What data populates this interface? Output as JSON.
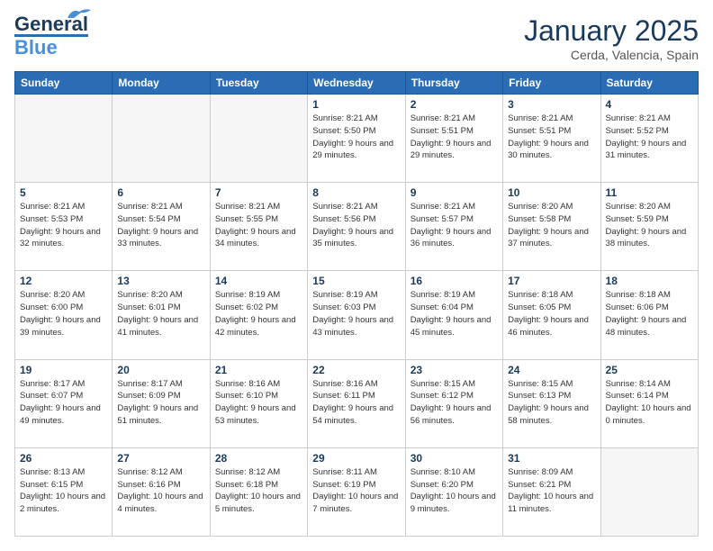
{
  "logo": {
    "line1": "General",
    "line2": "Blue"
  },
  "title": "January 2025",
  "location": "Cerda, Valencia, Spain",
  "days_header": [
    "Sunday",
    "Monday",
    "Tuesday",
    "Wednesday",
    "Thursday",
    "Friday",
    "Saturday"
  ],
  "weeks": [
    [
      {
        "day": "",
        "detail": ""
      },
      {
        "day": "",
        "detail": ""
      },
      {
        "day": "",
        "detail": ""
      },
      {
        "day": "1",
        "detail": "Sunrise: 8:21 AM\nSunset: 5:50 PM\nDaylight: 9 hours\nand 29 minutes."
      },
      {
        "day": "2",
        "detail": "Sunrise: 8:21 AM\nSunset: 5:51 PM\nDaylight: 9 hours\nand 29 minutes."
      },
      {
        "day": "3",
        "detail": "Sunrise: 8:21 AM\nSunset: 5:51 PM\nDaylight: 9 hours\nand 30 minutes."
      },
      {
        "day": "4",
        "detail": "Sunrise: 8:21 AM\nSunset: 5:52 PM\nDaylight: 9 hours\nand 31 minutes."
      }
    ],
    [
      {
        "day": "5",
        "detail": "Sunrise: 8:21 AM\nSunset: 5:53 PM\nDaylight: 9 hours\nand 32 minutes."
      },
      {
        "day": "6",
        "detail": "Sunrise: 8:21 AM\nSunset: 5:54 PM\nDaylight: 9 hours\nand 33 minutes."
      },
      {
        "day": "7",
        "detail": "Sunrise: 8:21 AM\nSunset: 5:55 PM\nDaylight: 9 hours\nand 34 minutes."
      },
      {
        "day": "8",
        "detail": "Sunrise: 8:21 AM\nSunset: 5:56 PM\nDaylight: 9 hours\nand 35 minutes."
      },
      {
        "day": "9",
        "detail": "Sunrise: 8:21 AM\nSunset: 5:57 PM\nDaylight: 9 hours\nand 36 minutes."
      },
      {
        "day": "10",
        "detail": "Sunrise: 8:20 AM\nSunset: 5:58 PM\nDaylight: 9 hours\nand 37 minutes."
      },
      {
        "day": "11",
        "detail": "Sunrise: 8:20 AM\nSunset: 5:59 PM\nDaylight: 9 hours\nand 38 minutes."
      }
    ],
    [
      {
        "day": "12",
        "detail": "Sunrise: 8:20 AM\nSunset: 6:00 PM\nDaylight: 9 hours\nand 39 minutes."
      },
      {
        "day": "13",
        "detail": "Sunrise: 8:20 AM\nSunset: 6:01 PM\nDaylight: 9 hours\nand 41 minutes."
      },
      {
        "day": "14",
        "detail": "Sunrise: 8:19 AM\nSunset: 6:02 PM\nDaylight: 9 hours\nand 42 minutes."
      },
      {
        "day": "15",
        "detail": "Sunrise: 8:19 AM\nSunset: 6:03 PM\nDaylight: 9 hours\nand 43 minutes."
      },
      {
        "day": "16",
        "detail": "Sunrise: 8:19 AM\nSunset: 6:04 PM\nDaylight: 9 hours\nand 45 minutes."
      },
      {
        "day": "17",
        "detail": "Sunrise: 8:18 AM\nSunset: 6:05 PM\nDaylight: 9 hours\nand 46 minutes."
      },
      {
        "day": "18",
        "detail": "Sunrise: 8:18 AM\nSunset: 6:06 PM\nDaylight: 9 hours\nand 48 minutes."
      }
    ],
    [
      {
        "day": "19",
        "detail": "Sunrise: 8:17 AM\nSunset: 6:07 PM\nDaylight: 9 hours\nand 49 minutes."
      },
      {
        "day": "20",
        "detail": "Sunrise: 8:17 AM\nSunset: 6:09 PM\nDaylight: 9 hours\nand 51 minutes."
      },
      {
        "day": "21",
        "detail": "Sunrise: 8:16 AM\nSunset: 6:10 PM\nDaylight: 9 hours\nand 53 minutes."
      },
      {
        "day": "22",
        "detail": "Sunrise: 8:16 AM\nSunset: 6:11 PM\nDaylight: 9 hours\nand 54 minutes."
      },
      {
        "day": "23",
        "detail": "Sunrise: 8:15 AM\nSunset: 6:12 PM\nDaylight: 9 hours\nand 56 minutes."
      },
      {
        "day": "24",
        "detail": "Sunrise: 8:15 AM\nSunset: 6:13 PM\nDaylight: 9 hours\nand 58 minutes."
      },
      {
        "day": "25",
        "detail": "Sunrise: 8:14 AM\nSunset: 6:14 PM\nDaylight: 10 hours\nand 0 minutes."
      }
    ],
    [
      {
        "day": "26",
        "detail": "Sunrise: 8:13 AM\nSunset: 6:15 PM\nDaylight: 10 hours\nand 2 minutes."
      },
      {
        "day": "27",
        "detail": "Sunrise: 8:12 AM\nSunset: 6:16 PM\nDaylight: 10 hours\nand 4 minutes."
      },
      {
        "day": "28",
        "detail": "Sunrise: 8:12 AM\nSunset: 6:18 PM\nDaylight: 10 hours\nand 5 minutes."
      },
      {
        "day": "29",
        "detail": "Sunrise: 8:11 AM\nSunset: 6:19 PM\nDaylight: 10 hours\nand 7 minutes."
      },
      {
        "day": "30",
        "detail": "Sunrise: 8:10 AM\nSunset: 6:20 PM\nDaylight: 10 hours\nand 9 minutes."
      },
      {
        "day": "31",
        "detail": "Sunrise: 8:09 AM\nSunset: 6:21 PM\nDaylight: 10 hours\nand 11 minutes."
      },
      {
        "day": "",
        "detail": ""
      }
    ]
  ]
}
